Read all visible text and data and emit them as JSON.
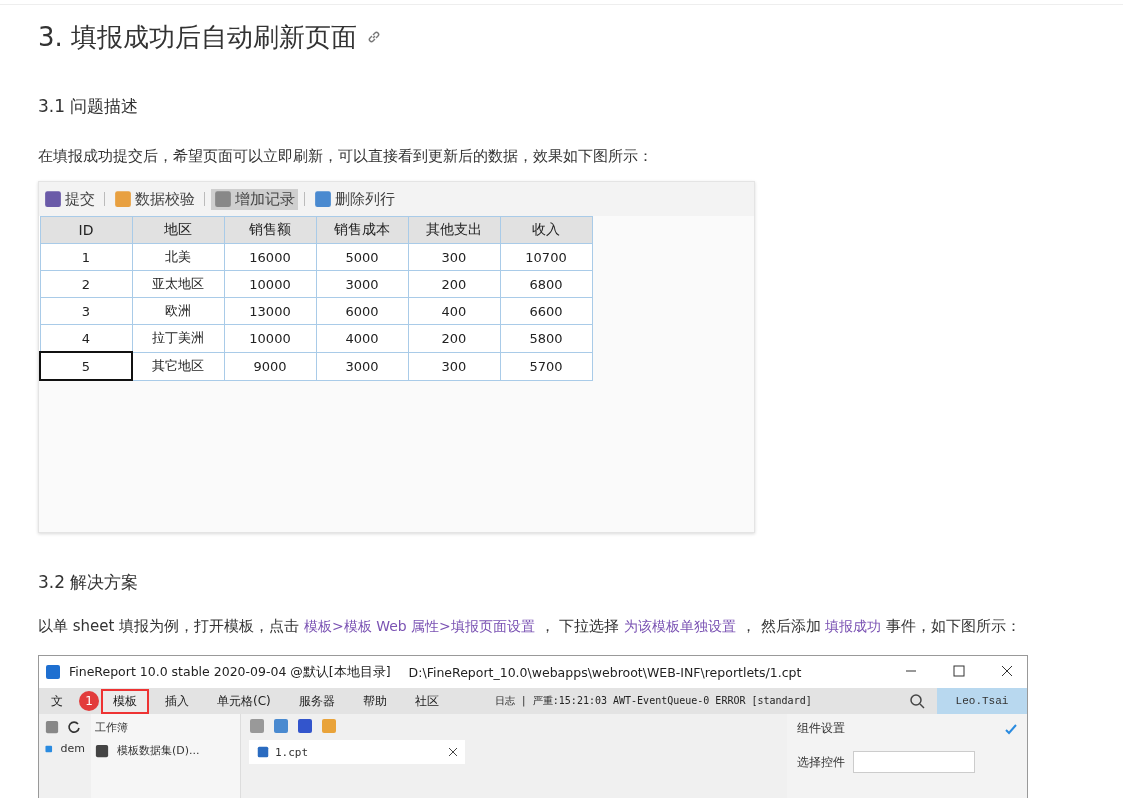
{
  "heading": "3. 填报成功后自动刷新页面",
  "section_1": {
    "title": "3.1 问题描述",
    "paragraph": "在填报成功提交后，希望页面可以立即刷新，可以直接看到更新后的数据，效果如下图所示："
  },
  "screenshot_1": {
    "toolbar": [
      {
        "label": "提交",
        "highlighted": false
      },
      {
        "label": "数据校验",
        "highlighted": false
      },
      {
        "label": "增加记录",
        "highlighted": true
      },
      {
        "label": "删除列行",
        "highlighted": false
      }
    ],
    "table": {
      "columns": [
        "ID",
        "地区",
        "销售额",
        "销售成本",
        "其他支出",
        "收入"
      ],
      "rows": [
        {
          "cells": [
            "1",
            "北美",
            "16000",
            "5000",
            "300",
            "10700"
          ],
          "selected": false
        },
        {
          "cells": [
            "2",
            "亚太地区",
            "10000",
            "3000",
            "200",
            "6800"
          ],
          "selected": false
        },
        {
          "cells": [
            "3",
            "欧洲",
            "13000",
            "6000",
            "400",
            "6600"
          ],
          "selected": false
        },
        {
          "cells": [
            "4",
            "拉丁美洲",
            "10000",
            "4000",
            "200",
            "5800"
          ],
          "selected": false
        },
        {
          "cells": [
            "5",
            "其它地区",
            "9000",
            "3000",
            "300",
            "5700"
          ],
          "selected": true
        }
      ]
    }
  },
  "section_2": {
    "title": "3.2 解决方案",
    "paragraph": [
      {
        "kind": "text",
        "text": "以单 sheet 填报为例，打开模板，点击 "
      },
      {
        "kind": "link",
        "text": "模板>模板 Web 属性>填报页面设置"
      },
      {
        "kind": "text",
        "text": " ， 下拉选择 "
      },
      {
        "kind": "link",
        "text": "为该模板单独设置"
      },
      {
        "kind": "text",
        "text": " ， 然后添加 "
      },
      {
        "kind": "link",
        "text": "填报成功"
      },
      {
        "kind": "text",
        "text": " 事件，如下图所示："
      }
    ]
  },
  "screenshot_2": {
    "title": "FineReport 10.0 stable 2020-09-04 @默认[本地目录]",
    "path": "D:\\FineReport_10.0\\webapps\\webroot\\WEB-INF\\reportlets/1.cpt",
    "menu": [
      {
        "label": "文",
        "highlighted": false
      },
      {
        "label": "模板",
        "highlighted": true
      },
      {
        "label": "插入",
        "highlighted": false
      },
      {
        "label": "单元格(C)",
        "highlighted": false
      },
      {
        "label": "服务器",
        "highlighted": false
      },
      {
        "label": "帮助",
        "highlighted": false
      },
      {
        "label": "社区",
        "highlighted": false
      }
    ],
    "step_badge": "1",
    "log": "日志 | 严重:15:21:03 AWT-EventQueue-0 ERROR [standard]",
    "user": "Leo.Tsai",
    "tree_item": "dem",
    "dropdown": {
      "group": "工作簿",
      "item": "模板数据集(D)..."
    },
    "tab": "1.cpt",
    "panel_title": "组件设置",
    "field_label": "选择控件"
  }
}
